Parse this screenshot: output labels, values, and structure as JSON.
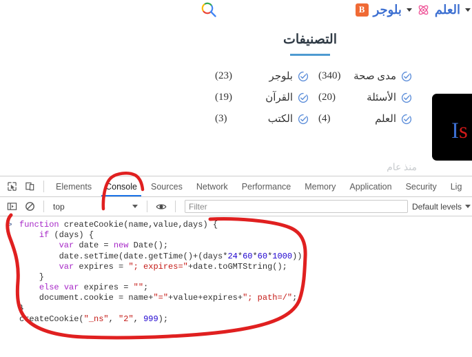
{
  "page": {
    "nav": {
      "search_icon": "google-search-icon",
      "blogger_label": "بلوجر",
      "blogger_icon": "B",
      "caret": "▼",
      "science_label": "العلم",
      "science_icon": "atom-icon"
    },
    "categories": {
      "title": "التصنيفات",
      "column_right": [
        {
          "label": "مدى صحة",
          "count": "(340)"
        },
        {
          "label": "الأسئلة",
          "count": "(20)"
        },
        {
          "label": "العلم",
          "count": "(4)"
        }
      ],
      "column_left": [
        {
          "label": "بلوجر",
          "count": "(23)"
        },
        {
          "label": "القرآن",
          "count": "(19)"
        },
        {
          "label": "الكتب",
          "count": "(3)"
        }
      ]
    },
    "promo": {
      "text_blue": "I",
      "text_red": "s"
    },
    "faint_text": "منذ عام"
  },
  "devtools": {
    "toolbar_icons": {
      "inspect": "inspect-element-icon",
      "device": "device-toolbar-icon"
    },
    "tabs": [
      {
        "label": "Elements",
        "active": false
      },
      {
        "label": "Console",
        "active": true
      },
      {
        "label": "Sources",
        "active": false
      },
      {
        "label": "Network",
        "active": false
      },
      {
        "label": "Performance",
        "active": false
      },
      {
        "label": "Memory",
        "active": false
      },
      {
        "label": "Application",
        "active": false
      },
      {
        "label": "Security",
        "active": false
      },
      {
        "label": "Lig",
        "active": false
      }
    ],
    "filterbar": {
      "sidebar_icon": "console-sidebar-icon",
      "clear_icon": "clear-console-icon",
      "context": "top",
      "eye_icon": "live-expression-eye-icon",
      "filter_placeholder": "Filter",
      "filter_value": "",
      "levels": "Default levels"
    },
    "console": {
      "prompt": ">",
      "code_lines": [
        [
          {
            "t": "function ",
            "c": "kw"
          },
          {
            "t": "createCookie(name,value,days) {",
            "c": "pln"
          }
        ],
        [
          {
            "t": "    ",
            "c": "pln"
          },
          {
            "t": "if",
            "c": "kw"
          },
          {
            "t": " (days) {",
            "c": "pln"
          }
        ],
        [
          {
            "t": "        ",
            "c": "pln"
          },
          {
            "t": "var",
            "c": "kw"
          },
          {
            "t": " date = ",
            "c": "pln"
          },
          {
            "t": "new",
            "c": "kw"
          },
          {
            "t": " Date();",
            "c": "pln"
          }
        ],
        [
          {
            "t": "        date.setTime(date.getTime()+(days*",
            "c": "pln"
          },
          {
            "t": "24",
            "c": "num"
          },
          {
            "t": "*",
            "c": "pln"
          },
          {
            "t": "60",
            "c": "num"
          },
          {
            "t": "*",
            "c": "pln"
          },
          {
            "t": "60",
            "c": "num"
          },
          {
            "t": "*",
            "c": "pln"
          },
          {
            "t": "1000",
            "c": "num"
          },
          {
            "t": "));",
            "c": "pln"
          }
        ],
        [
          {
            "t": "        ",
            "c": "pln"
          },
          {
            "t": "var",
            "c": "kw"
          },
          {
            "t": " expires = ",
            "c": "pln"
          },
          {
            "t": "\"; expires=\"",
            "c": "str"
          },
          {
            "t": "+date.toGMTString();",
            "c": "pln"
          }
        ],
        [
          {
            "t": "    }",
            "c": "pln"
          }
        ],
        [
          {
            "t": "    ",
            "c": "pln"
          },
          {
            "t": "else var",
            "c": "kw"
          },
          {
            "t": " expires = ",
            "c": "pln"
          },
          {
            "t": "\"\"",
            "c": "str"
          },
          {
            "t": ";",
            "c": "pln"
          }
        ],
        [
          {
            "t": "    document.cookie = name+",
            "c": "pln"
          },
          {
            "t": "\"=\"",
            "c": "str"
          },
          {
            "t": "+value+expires+",
            "c": "pln"
          },
          {
            "t": "\"; path=/\"",
            "c": "str"
          },
          {
            "t": ";",
            "c": "pln"
          }
        ],
        [
          {
            "t": "}",
            "c": "pln"
          }
        ],
        [
          {
            "t": "createCookie(",
            "c": "pln"
          },
          {
            "t": "\"_ns\"",
            "c": "str"
          },
          {
            "t": ", ",
            "c": "pln"
          },
          {
            "t": "\"2\"",
            "c": "str"
          },
          {
            "t": ", ",
            "c": "pln"
          },
          {
            "t": "999",
            "c": "num"
          },
          {
            "t": ");",
            "c": "pln"
          }
        ]
      ]
    }
  },
  "annotations": {
    "color": "#e02020",
    "console_tab_arc": "hand-drawn-arc-over-console-tab",
    "code_circle": "hand-drawn-circle-around-console-code"
  }
}
